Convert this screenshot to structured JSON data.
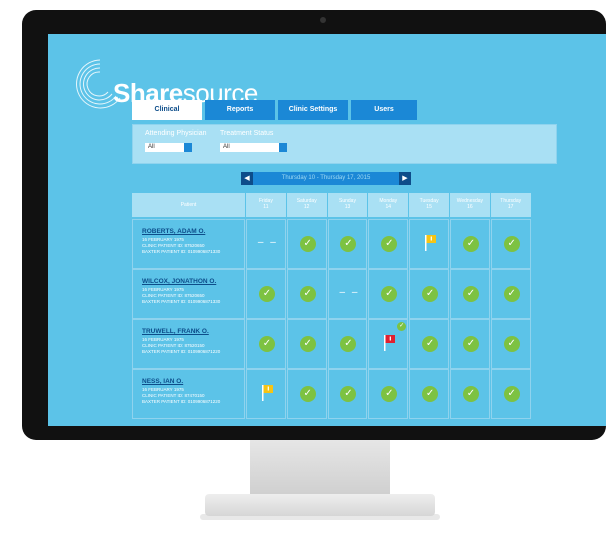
{
  "app": {
    "logo_bold": "Share",
    "logo_rest": "source"
  },
  "tabs": [
    {
      "label": "Clinical",
      "active": true
    },
    {
      "label": "Reports",
      "active": false
    },
    {
      "label": "Clinic Settings",
      "active": false
    },
    {
      "label": "Users",
      "active": false
    }
  ],
  "filters": {
    "attending_label": "Attending Physician",
    "attending_value": "All",
    "status_label": "Treatment Status",
    "status_value": "All"
  },
  "week_nav": {
    "label": "Thursday 10 - Thursday 17, 2015"
  },
  "table": {
    "patient_header": "Patient",
    "days": [
      {
        "day": "Friday",
        "date": "11"
      },
      {
        "day": "Saturday",
        "date": "12"
      },
      {
        "day": "Sunday",
        "date": "13"
      },
      {
        "day": "Monday",
        "date": "14"
      },
      {
        "day": "Tuesday",
        "date": "15"
      },
      {
        "day": "Wednesday",
        "date": "16"
      },
      {
        "day": "Thursday",
        "date": "17"
      }
    ],
    "rows": [
      {
        "name": "ROBERTS, ADAM O.",
        "dob": "16 FEBRUARY 1975",
        "clinic_id": "CLINIC PATIENT ID: 87520650",
        "baxter_id": "BAXTER PATIENT ID: 0109906871330",
        "statuses": [
          "none",
          "check",
          "check",
          "check",
          "flag-yellow",
          "check",
          "check"
        ]
      },
      {
        "name": "WILCOX, JONATHON O.",
        "dob": "16 FEBRUARY 1975",
        "clinic_id": "CLINIC PATIENT ID: 87520650",
        "baxter_id": "BAXTER PATIENT ID: 0109906871330",
        "statuses": [
          "check",
          "check",
          "none",
          "check",
          "check",
          "check",
          "check"
        ]
      },
      {
        "name": "TRUWELL, FRANK O.",
        "dob": "16 FEBRUARY 1975",
        "clinic_id": "CLINIC PATIENT ID: 87520150",
        "baxter_id": "BAXTER PATIENT ID: 0109906871220",
        "statuses": [
          "check",
          "check",
          "check",
          "flag-red",
          "check",
          "check",
          "check"
        ]
      },
      {
        "name": "NESS, IAN O.",
        "dob": "16 FEBRUARY 1975",
        "clinic_id": "CLINIC PATIENT ID: 87470150",
        "baxter_id": "BAXTER PATIENT ID: 0109906871220",
        "statuses": [
          "flag-yellow",
          "check",
          "check",
          "check",
          "check",
          "check",
          "check"
        ]
      }
    ]
  },
  "colors": {
    "screen_bg": "#5cc3e8",
    "tab_blue": "#1b88d6",
    "check_green": "#7dc242",
    "flag_yellow": "#f6c415",
    "flag_red": "#e02030"
  },
  "icons": {
    "check": "check-circle-icon",
    "none": "dash-icon",
    "flag_yellow": "flag-yellow-icon",
    "flag_red": "flag-red-icon"
  }
}
